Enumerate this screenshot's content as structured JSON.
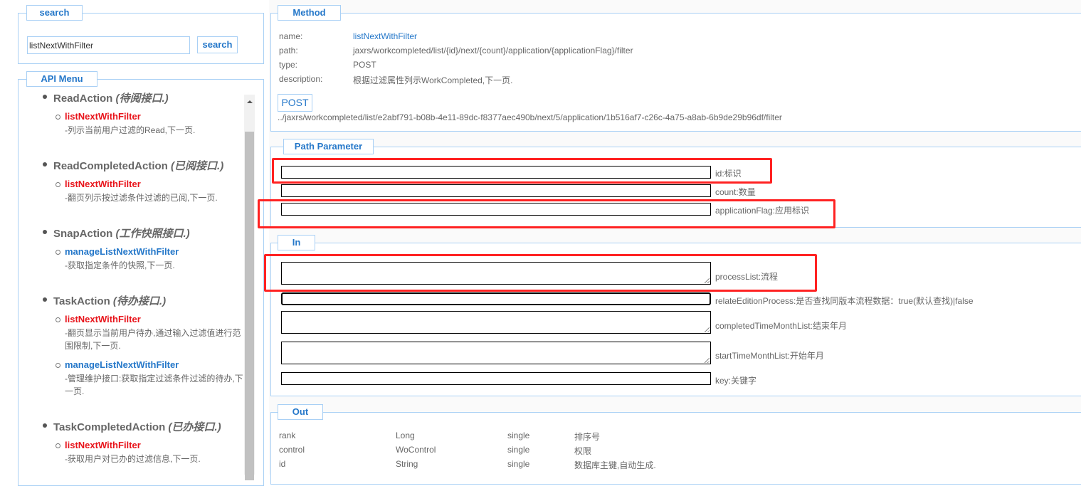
{
  "search": {
    "legend": "search",
    "value": "listNextWithFilter",
    "button": "search"
  },
  "menu": {
    "legend": "API Menu",
    "groups": [
      {
        "name": "ReadAction",
        "note": "(待阅接口.)",
        "items": [
          {
            "link": "listNextWithFilter",
            "desc": "-列示当前用户过滤的Read,下一页."
          }
        ]
      },
      {
        "name": "ReadCompletedAction",
        "note": "(已阅接口.)",
        "items": [
          {
            "link": "listNextWithFilter",
            "desc": "-翻页列示按过滤条件过滤的已阅,下一页."
          }
        ]
      },
      {
        "name": "SnapAction",
        "note": "(工作快照接口.)",
        "items": [
          {
            "link": "manageListNextWithFilter",
            "desc": "-获取指定条件的快照,下一页."
          }
        ]
      },
      {
        "name": "TaskAction",
        "note": "(待办接口.)",
        "items": [
          {
            "link": "listNextWithFilter",
            "desc": "-翻页显示当前用户待办,通过输入过滤值进行范围限制,下一页."
          },
          {
            "link": "manageListNextWithFilter",
            "desc": "-管理维护接口:获取指定过滤条件过滤的待办,下一页."
          }
        ]
      },
      {
        "name": "TaskCompletedAction",
        "note": "(已办接口.)",
        "items": [
          {
            "link": "listNextWithFilter",
            "desc": "-获取用户对已办的过滤信息,下一页."
          }
        ]
      }
    ]
  },
  "method": {
    "legend": "Method",
    "rows": [
      {
        "label": "name:",
        "value": "listNextWithFilter"
      },
      {
        "label": "path:",
        "value": "jaxrs/workcompleted/list/{id}/next/{count}/application/{applicationFlag}/filter"
      },
      {
        "label": "type:",
        "value": "POST"
      },
      {
        "label": "description:",
        "value": "根据过滤属性列示WorkCompleted,下一页."
      }
    ],
    "button": "POST",
    "url": "../jaxrs/workcompleted/list/e2abf791-b08b-4e11-89dc-f8377aec490b/next/5/application/1b516af7-c26c-4a75-a8ab-6b9de29b96df/filter"
  },
  "path_params": {
    "legend": "Path Parameter",
    "fields": [
      "id:标识",
      "count:数量",
      "applicationFlag:应用标识"
    ]
  },
  "in": {
    "legend": "In",
    "fields": [
      "processList:流程",
      "relateEditionProcess:是否查找同版本流程数据：true(默认查找)|false",
      "completedTimeMonthList:结束年月",
      "startTimeMonthList:开始年月",
      "key:关键字"
    ]
  },
  "out": {
    "legend": "Out",
    "rows": [
      [
        "rank",
        "Long",
        "single",
        "排序号"
      ],
      [
        "control",
        "WoControl",
        "single",
        "权限"
      ],
      [
        "id",
        "String",
        "single",
        "数据库主键,自动生成."
      ]
    ]
  },
  "colors": {
    "accent": "#2477c9",
    "link_red": "#e8141b",
    "link_blue": "#2477c9",
    "highlight": "#ff2222"
  }
}
